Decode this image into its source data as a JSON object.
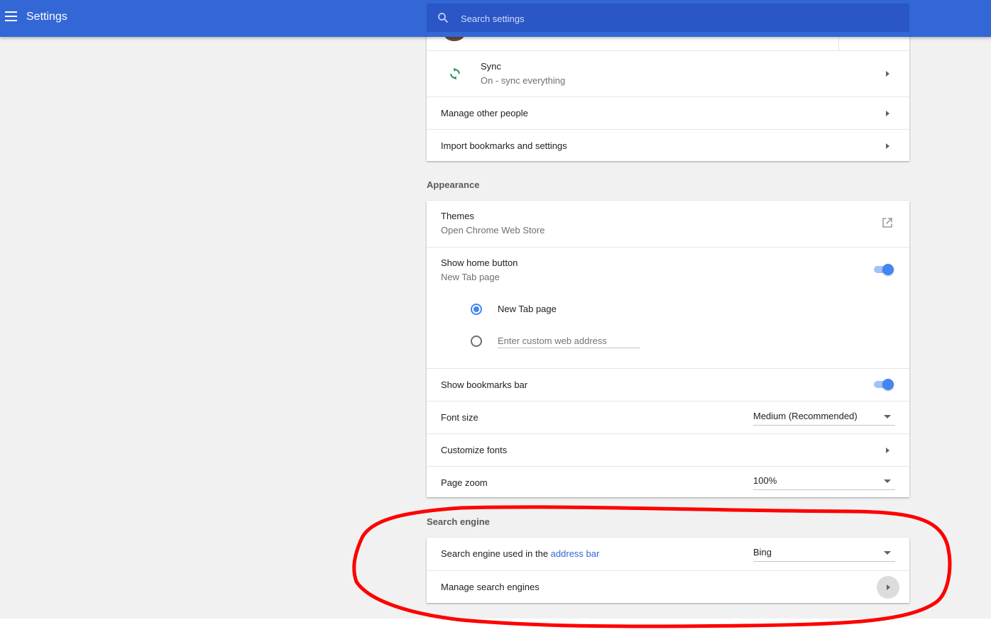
{
  "header": {
    "title": "Settings",
    "search_placeholder": "Search settings"
  },
  "people": {
    "account_label": "",
    "sync_label": "Sync",
    "sync_status": "On - sync everything",
    "manage_people": "Manage other people",
    "import": "Import bookmarks and settings"
  },
  "appearance": {
    "section_title": "Appearance",
    "themes_label": "Themes",
    "themes_sub": "Open Chrome Web Store",
    "home_button_label": "Show home button",
    "home_button_sub": "New Tab page",
    "home_button_on": true,
    "radio_new_tab": "New Tab page",
    "custom_address_placeholder": "Enter custom web address",
    "bookmarks_bar_label": "Show bookmarks bar",
    "bookmarks_bar_on": true,
    "font_size_label": "Font size",
    "font_size_value": "Medium (Recommended)",
    "customize_fonts": "Customize fonts",
    "page_zoom_label": "Page zoom",
    "page_zoom_value": "100%"
  },
  "search_engine": {
    "section_title": "Search engine",
    "used_in_label": "Search engine used in the ",
    "used_in_link": "address bar",
    "engine_value": "Bing",
    "manage_label": "Manage search engines"
  },
  "colors": {
    "header_blue": "#3367d6",
    "accent": "#4285f4",
    "annotation_red": "#ff0000"
  }
}
